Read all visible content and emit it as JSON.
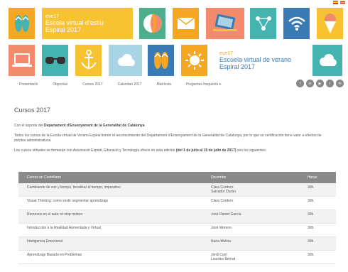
{
  "flags": [
    "es",
    "ca"
  ],
  "banner": {
    "top_title": {
      "brand": "eve17",
      "line1": "Escola virtual d'estiu",
      "line2": "Espiral 2017"
    },
    "bottom_title": {
      "brand": "eve17",
      "line1": "Escuela virtual de verano",
      "line2": "Espiral 2017"
    },
    "colors": {
      "green": "#4cae8a",
      "orange": "#f5a623",
      "teal": "#45b4b0",
      "salmon": "#f28a6c",
      "yellow": "#f7c331",
      "blue": "#3a7bb5",
      "lightblue": "#a8d4e6"
    }
  },
  "nav": {
    "items": [
      "Presentació",
      "Objectius",
      "Cursos 2017",
      "Calendari 2017",
      "Matrícula",
      "Preguntes freqüents ▾"
    ]
  },
  "social": [
    "f",
    "in",
    "▶",
    "t",
    "✉"
  ],
  "content": {
    "title": "Cursos 2017",
    "p1_pre": "Con el soporte del ",
    "p1_bold": "Departament d'Ensenyament de la Generalitat de Catalunya",
    "p2": "Todos los cursos de la Escola virtual de Verano Espiral tienen el reconocimiento del Departament d'Ensenyament de la Generalitat de Catalunya, por lo que su certificación tiene valor a efectos de méritos administrativos.",
    "p3_pre": "Los cursos virtuales se formarán con Associació Espiral, Educació y Tecnología ofrece en esta edición ",
    "p3_bold": "(del 1 de julio al 15 de julio de 2017)",
    "p3_post": " son los siguientes:"
  },
  "table": {
    "headers": [
      "Cursos en Castellano",
      "Docentes",
      "Horas"
    ],
    "rows": [
      {
        "course": "Cambiando de voz y tiempo, fiscalizar el tiempo, imperativo",
        "teachers": [
          "Clara Cordero",
          "Salvador Durán"
        ],
        "hours": "30h."
      },
      {
        "course": "Visual Thinking: como vestir segmentar aprendizaje",
        "teachers": [
          "Clara Cordero"
        ],
        "hours": "30h."
      },
      {
        "course": "Recursos en el aula: el stop motion",
        "teachers": [
          "José Daniel García"
        ],
        "hours": "30h."
      },
      {
        "course": "Introducción a la Realidad Aumentada y Virtual",
        "teachers": [
          "José Moreno"
        ],
        "hours": "30h."
      },
      {
        "course": "Inteligencia Emocional",
        "teachers": [
          "Nuria Molina"
        ],
        "hours": "30h."
      },
      {
        "course": "Aprendizaje Basado en Problemas",
        "teachers": [
          "Jordi Cuní",
          "Lourdes Bernat"
        ],
        "hours": "30h."
      }
    ]
  }
}
